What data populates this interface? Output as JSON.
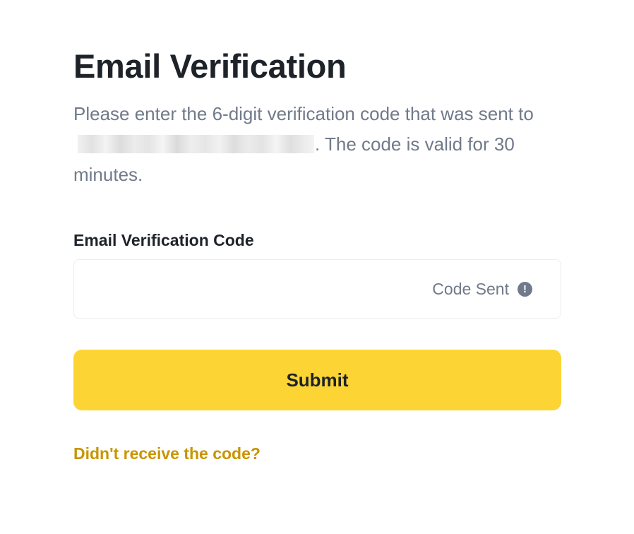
{
  "page": {
    "title": "Email Verification",
    "description_before": "Please enter the 6-digit verification code that was sent to",
    "description_after": ". The code is valid for 30 minutes."
  },
  "field": {
    "label": "Email Verification Code",
    "value": "",
    "status_text": "Code Sent",
    "status_icon": "exclamation-circle-icon"
  },
  "submit": {
    "label": "Submit"
  },
  "resend": {
    "label": "Didn't receive the code?"
  },
  "colors": {
    "accent": "#fcd535",
    "link": "#c99400",
    "text_primary": "#1e2329",
    "text_secondary": "#707a8a",
    "border": "#eaecef"
  }
}
